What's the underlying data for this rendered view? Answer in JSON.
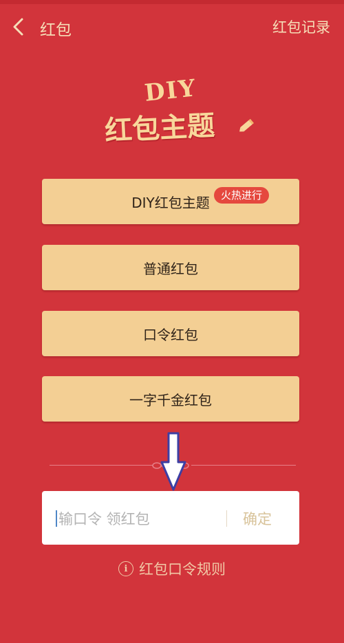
{
  "header": {
    "title": "红包",
    "record_link": "红包记录",
    "back_icon": "chevron-left-icon"
  },
  "logo": {
    "line1": "DIY",
    "line2": "红包主题",
    "pencil_icon": "pencil-icon"
  },
  "options": [
    {
      "label": "DIY红包主题",
      "badge": "火热进行"
    },
    {
      "label": "普通红包"
    },
    {
      "label": "口令红包"
    },
    {
      "label": "一字千金红包"
    }
  ],
  "password": {
    "placeholder": "输口令 领红包",
    "value": "",
    "confirm_label": "确定"
  },
  "rules": {
    "icon": "info-icon",
    "label": "红包口令规则"
  },
  "overlay": {
    "arrow_icon": "down-arrow-icon"
  },
  "colors": {
    "background": "#d2343b",
    "button": "#f3cf94",
    "badge": "#e5483e",
    "arrow": "#3d3fa3"
  }
}
